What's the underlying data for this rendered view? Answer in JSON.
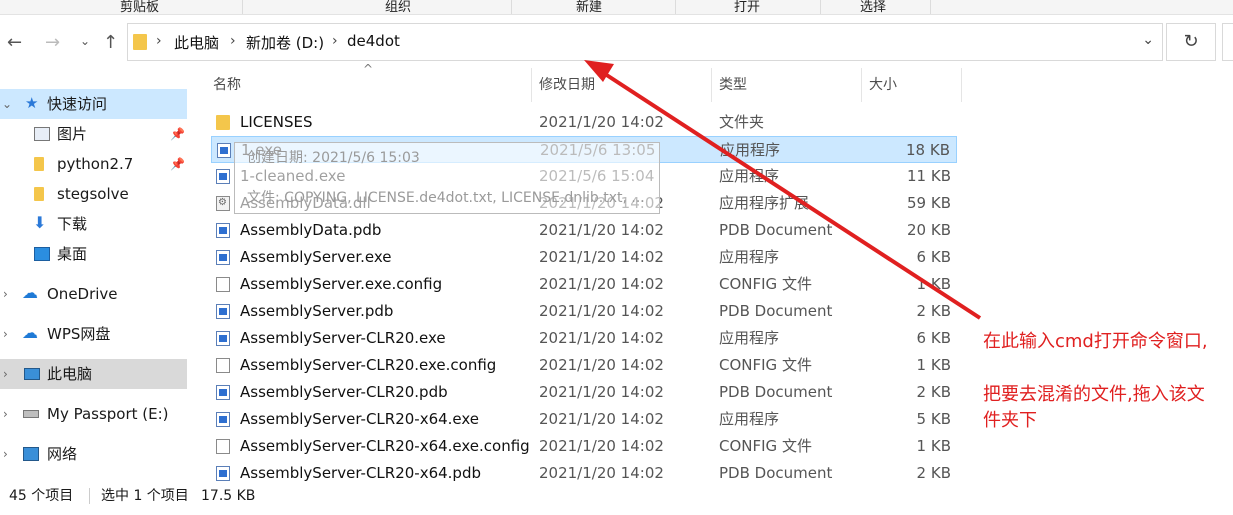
{
  "ribbon": {
    "groups": [
      "剪贴板",
      "组织",
      "新建",
      "打开",
      "选择"
    ]
  },
  "nav": {
    "back": "←",
    "forward": "→",
    "up": "↑",
    "refresh": "↻",
    "dropdown": "⌄"
  },
  "address": {
    "crumbs": [
      "此电脑",
      "新加卷 (D:)",
      "de4dot"
    ]
  },
  "sidebar": {
    "items": [
      {
        "label": "快速访问",
        "icon": "star-icon"
      },
      {
        "label": "图片",
        "icon": "pictures-icon"
      },
      {
        "label": "python2.7",
        "icon": "folder-icon"
      },
      {
        "label": "stegsolve",
        "icon": "folder-icon"
      },
      {
        "label": "下载",
        "icon": "download-icon"
      },
      {
        "label": "桌面",
        "icon": "desktop-icon"
      },
      {
        "label": "OneDrive",
        "icon": "cloud-icon"
      },
      {
        "label": "WPS网盘",
        "icon": "wps-cloud-icon"
      },
      {
        "label": "此电脑",
        "icon": "computer-icon"
      },
      {
        "label": "My Passport (E:)",
        "icon": "drive-icon"
      },
      {
        "label": "网络",
        "icon": "network-icon"
      }
    ]
  },
  "columns": {
    "name": "名称",
    "date": "修改日期",
    "type": "类型",
    "size": "大小"
  },
  "files": [
    {
      "name": "LICENSES",
      "date": "2021/1/20 14:02",
      "type": "文件夹",
      "size": "",
      "icon": "folder"
    },
    {
      "name": "1.exe",
      "date": "2021/5/6 13:05",
      "type": "应用程序",
      "size": "18 KB",
      "icon": "exe"
    },
    {
      "name": "1-cleaned.exe",
      "date": "2021/5/6 15:04",
      "type": "应用程序",
      "size": "11 KB",
      "icon": "exe"
    },
    {
      "name": "AssemblyData.dll",
      "date": "2021/1/20 14:02",
      "type": "应用程序扩展",
      "size": "59 KB",
      "icon": "dll"
    },
    {
      "name": "AssemblyData.pdb",
      "date": "2021/1/20 14:02",
      "type": "PDB Document",
      "size": "20 KB",
      "icon": "exe"
    },
    {
      "name": "AssemblyServer.exe",
      "date": "2021/1/20 14:02",
      "type": "应用程序",
      "size": "6 KB",
      "icon": "exe"
    },
    {
      "name": "AssemblyServer.exe.config",
      "date": "2021/1/20 14:02",
      "type": "CONFIG 文件",
      "size": "1 KB",
      "icon": "doc"
    },
    {
      "name": "AssemblyServer.pdb",
      "date": "2021/1/20 14:02",
      "type": "PDB Document",
      "size": "2 KB",
      "icon": "exe"
    },
    {
      "name": "AssemblyServer-CLR20.exe",
      "date": "2021/1/20 14:02",
      "type": "应用程序",
      "size": "6 KB",
      "icon": "exe"
    },
    {
      "name": "AssemblyServer-CLR20.exe.config",
      "date": "2021/1/20 14:02",
      "type": "CONFIG 文件",
      "size": "1 KB",
      "icon": "doc"
    },
    {
      "name": "AssemblyServer-CLR20.pdb",
      "date": "2021/1/20 14:02",
      "type": "PDB Document",
      "size": "2 KB",
      "icon": "exe"
    },
    {
      "name": "AssemblyServer-CLR20-x64.exe",
      "date": "2021/1/20 14:02",
      "type": "应用程序",
      "size": "5 KB",
      "icon": "exe"
    },
    {
      "name": "AssemblyServer-CLR20-x64.exe.config",
      "date": "2021/1/20 14:02",
      "type": "CONFIG 文件",
      "size": "1 KB",
      "icon": "doc"
    },
    {
      "name": "AssemblyServer-CLR20-x64.pdb",
      "date": "2021/1/20 14:02",
      "type": "PDB Document",
      "size": "2 KB",
      "icon": "exe"
    }
  ],
  "tooltip": {
    "line1": "创建日期: 2021/5/6 15:03",
    "line2": "文件: COPYING, LICENSE.de4dot.txt, LICENSE.dnlib.txt, ..."
  },
  "status": {
    "count": "45 个项目",
    "selected": "选中 1 个项目",
    "size": "17.5 KB"
  },
  "annotation": {
    "line1": "在此输入cmd打开命令窗口,",
    "line2": "把要去混淆的文件,拖入该文",
    "line3": "件夹下",
    "color": "#e02020"
  }
}
